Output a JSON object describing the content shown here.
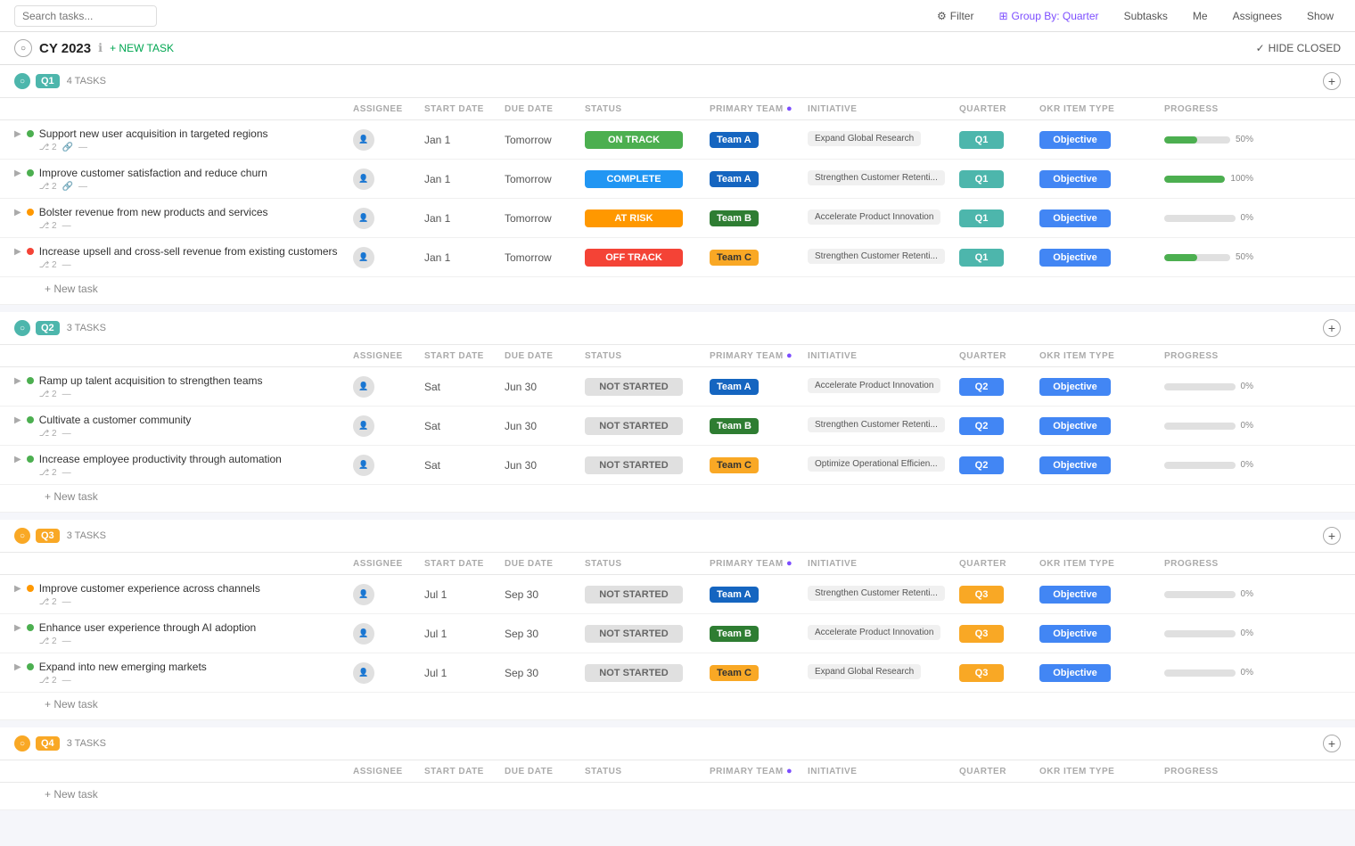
{
  "topBar": {
    "searchPlaceholder": "Search tasks...",
    "filterLabel": "Filter",
    "groupByLabel": "Group By: Quarter",
    "subtasksLabel": "Subtasks",
    "meLabel": "Me",
    "assigneesLabel": "Assignees",
    "showLabel": "Show"
  },
  "pageHeader": {
    "title": "CY 2023",
    "newTaskLabel": "+ NEW TASK",
    "hideClosedLabel": "HIDE CLOSED"
  },
  "columns": {
    "assignee": "ASSIGNEE",
    "startDate": "START DATE",
    "dueDate": "DUE DATE",
    "status": "STATUS",
    "primaryTeam": "PRIMARY TEAM",
    "initiative": "INITIATIVE",
    "quarter": "QUARTER",
    "okrItemType": "OKR ITEM TYPE",
    "progress": "PROGRESS"
  },
  "quarters": [
    {
      "id": "q1",
      "label": "Q1",
      "tasksCount": "4 TASKS",
      "colorClass": "q1-color",
      "badgeClass": "q1-badge",
      "tasks": [
        {
          "name": "Support new user acquisition in targeted regions",
          "subtaskCount": "2",
          "hasLink": true,
          "dotColor": "dot-green",
          "assignee": "",
          "startDate": "Jan 1",
          "dueDate": "Tomorrow",
          "status": "ON TRACK",
          "statusClass": "status-on-track",
          "team": "Team A",
          "teamClass": "team-a",
          "initiative": "Expand Global Research",
          "quarter": "Q1",
          "quarterClass": "qcell-q1",
          "okrType": "Objective",
          "progress": 50
        },
        {
          "name": "Improve customer satisfaction and reduce churn",
          "subtaskCount": "2",
          "hasLink": true,
          "dotColor": "dot-green",
          "assignee": "",
          "startDate": "Jan 1",
          "dueDate": "Tomorrow",
          "status": "COMPLETE",
          "statusClass": "status-complete",
          "team": "Team A",
          "teamClass": "team-a",
          "initiative": "Strengthen Customer Retenti...",
          "quarter": "Q1",
          "quarterClass": "qcell-q1",
          "okrType": "Objective",
          "progress": 100
        },
        {
          "name": "Bolster revenue from new products and services",
          "subtaskCount": "2",
          "hasLink": false,
          "dotColor": "dot-orange",
          "assignee": "",
          "startDate": "Jan 1",
          "dueDate": "Tomorrow",
          "status": "AT RISK",
          "statusClass": "status-at-risk",
          "team": "Team B",
          "teamClass": "team-b",
          "initiative": "Accelerate Product Innovation",
          "quarter": "Q1",
          "quarterClass": "qcell-q1",
          "okrType": "Objective",
          "progress": 0
        },
        {
          "name": "Increase upsell and cross-sell revenue from existing customers",
          "subtaskCount": "2",
          "hasLink": false,
          "dotColor": "dot-red",
          "assignee": "",
          "startDate": "Jan 1",
          "dueDate": "Tomorrow",
          "status": "OFF TRACK",
          "statusClass": "status-off-track",
          "team": "Team C",
          "teamClass": "team-c",
          "initiative": "Strengthen Customer Retenti...",
          "quarter": "Q1",
          "quarterClass": "qcell-q1",
          "okrType": "Objective",
          "progress": 50
        }
      ]
    },
    {
      "id": "q2",
      "label": "Q2",
      "tasksCount": "3 TASKS",
      "colorClass": "q2-color",
      "badgeClass": "q2-badge",
      "tasks": [
        {
          "name": "Ramp up talent acquisition to strengthen teams",
          "subtaskCount": "2",
          "hasLink": false,
          "dotColor": "dot-green",
          "assignee": "",
          "startDate": "Sat",
          "dueDate": "Jun 30",
          "status": "NOT STARTED",
          "statusClass": "status-not-started",
          "team": "Team A",
          "teamClass": "team-a",
          "initiative": "Accelerate Product Innovation",
          "quarter": "Q2",
          "quarterClass": "qcell-q2",
          "okrType": "Objective",
          "progress": 0
        },
        {
          "name": "Cultivate a customer community",
          "subtaskCount": "2",
          "hasLink": false,
          "dotColor": "dot-green",
          "assignee": "",
          "startDate": "Sat",
          "dueDate": "Jun 30",
          "status": "NOT STARTED",
          "statusClass": "status-not-started",
          "team": "Team B",
          "teamClass": "team-b",
          "initiative": "Strengthen Customer Retenti...",
          "quarter": "Q2",
          "quarterClass": "qcell-q2",
          "okrType": "Objective",
          "progress": 0
        },
        {
          "name": "Increase employee productivity through automation",
          "subtaskCount": "2",
          "hasLink": false,
          "dotColor": "dot-green",
          "assignee": "",
          "startDate": "Sat",
          "dueDate": "Jun 30",
          "status": "NOT STARTED",
          "statusClass": "status-not-started",
          "team": "Team C",
          "teamClass": "team-c",
          "initiative": "Optimize Operational Efficien...",
          "quarter": "Q2",
          "quarterClass": "qcell-q2",
          "okrType": "Objective",
          "progress": 0
        }
      ]
    },
    {
      "id": "q3",
      "label": "Q3",
      "tasksCount": "3 TASKS",
      "colorClass": "q3-color",
      "badgeClass": "q3-badge",
      "tasks": [
        {
          "name": "Improve customer experience across channels",
          "subtaskCount": "2",
          "hasLink": false,
          "dotColor": "dot-orange",
          "assignee": "",
          "startDate": "Jul 1",
          "dueDate": "Sep 30",
          "status": "NOT STARTED",
          "statusClass": "status-not-started",
          "team": "Team A",
          "teamClass": "team-a",
          "initiative": "Strengthen Customer Retenti...",
          "quarter": "Q3",
          "quarterClass": "qcell-q3",
          "okrType": "Objective",
          "progress": 0
        },
        {
          "name": "Enhance user experience through AI adoption",
          "subtaskCount": "2",
          "hasLink": false,
          "dotColor": "dot-green",
          "assignee": "",
          "startDate": "Jul 1",
          "dueDate": "Sep 30",
          "status": "NOT STARTED",
          "statusClass": "status-not-started",
          "team": "Team B",
          "teamClass": "team-b",
          "initiative": "Accelerate Product Innovation",
          "quarter": "Q3",
          "quarterClass": "qcell-q3",
          "okrType": "Objective",
          "progress": 0
        },
        {
          "name": "Expand into new emerging markets",
          "subtaskCount": "2",
          "hasLink": false,
          "dotColor": "dot-green",
          "assignee": "",
          "startDate": "Jul 1",
          "dueDate": "Sep 30",
          "status": "NOT STARTED",
          "statusClass": "status-not-started",
          "team": "Team C",
          "teamClass": "team-c",
          "initiative": "Expand Global Research",
          "quarter": "Q3",
          "quarterClass": "qcell-q3",
          "okrType": "Objective",
          "progress": 0
        }
      ]
    },
    {
      "id": "q4",
      "label": "Q4",
      "tasksCount": "3 TASKS",
      "colorClass": "q4-color",
      "badgeClass": "q4-badge",
      "tasks": []
    }
  ],
  "newTaskLabel": "+ New task"
}
